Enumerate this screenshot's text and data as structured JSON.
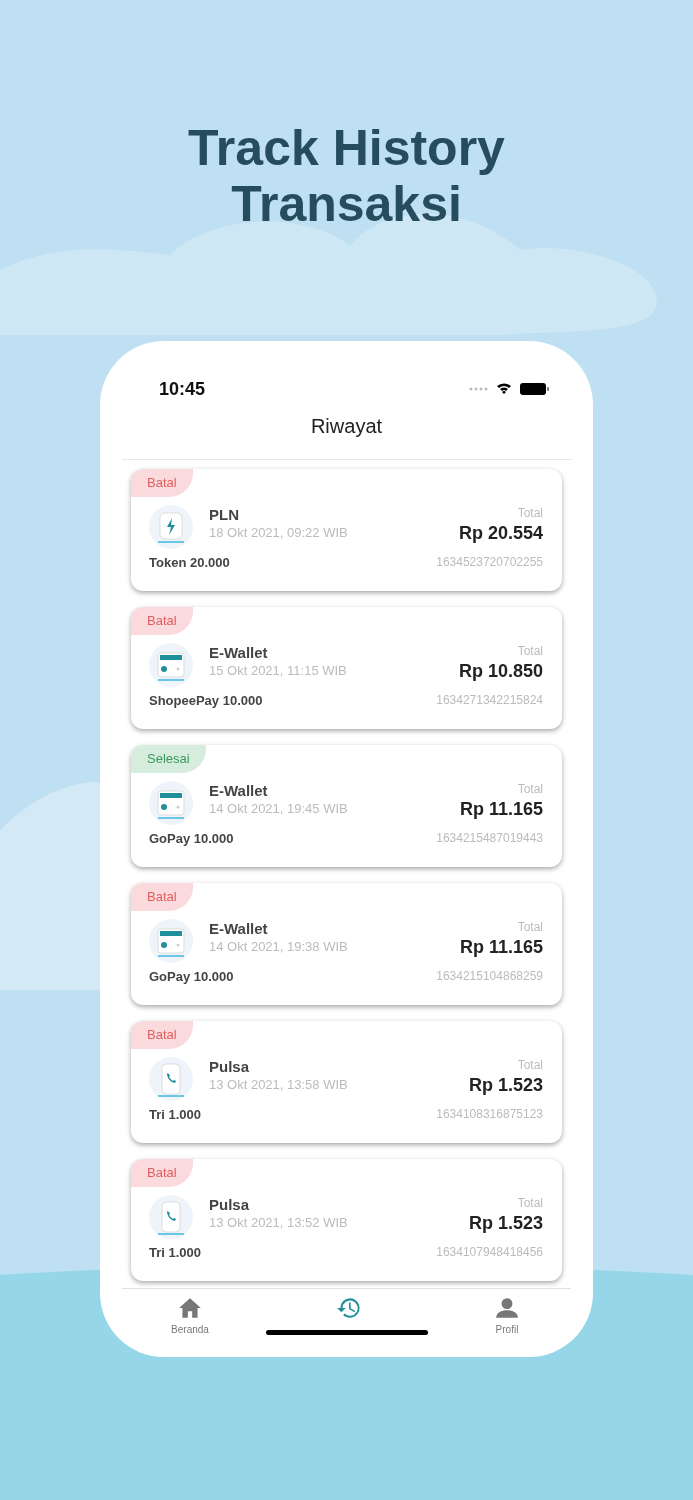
{
  "headline": [
    "Track History",
    "Transaksi"
  ],
  "status_bar": {
    "time": "10:45"
  },
  "header": {
    "title": "Riwayat"
  },
  "transactions": [
    {
      "status": {
        "label": "Batal",
        "kind": "cancelled"
      },
      "kind": "electricity",
      "name": "PLN",
      "date": "18 Okt 2021, 09:22 WIB",
      "product": "Token 20.000",
      "total_label": "Total",
      "amount": "Rp 20.554",
      "reference": "1634523720702255"
    },
    {
      "status": {
        "label": "Batal",
        "kind": "cancelled"
      },
      "kind": "wallet",
      "name": "E-Wallet",
      "date": "15 Okt 2021, 11:15 WIB",
      "product": "ShopeePay 10.000",
      "total_label": "Total",
      "amount": "Rp 10.850",
      "reference": "1634271342215824"
    },
    {
      "status": {
        "label": "Selesai",
        "kind": "done"
      },
      "kind": "wallet",
      "name": "E-Wallet",
      "date": "14 Okt 2021, 19:45 WIB",
      "product": "GoPay 10.000",
      "total_label": "Total",
      "amount": "Rp 11.165",
      "reference": "1634215487019443"
    },
    {
      "status": {
        "label": "Batal",
        "kind": "cancelled"
      },
      "kind": "wallet",
      "name": "E-Wallet",
      "date": "14 Okt 2021, 19:38 WIB",
      "product": "GoPay 10.000",
      "total_label": "Total",
      "amount": "Rp 11.165",
      "reference": "1634215104868259"
    },
    {
      "status": {
        "label": "Batal",
        "kind": "cancelled"
      },
      "kind": "phone",
      "name": "Pulsa",
      "date": "13 Okt 2021, 13:58 WIB",
      "product": "Tri 1.000",
      "total_label": "Total",
      "amount": "Rp 1.523",
      "reference": "1634108316875123"
    },
    {
      "status": {
        "label": "Batal",
        "kind": "cancelled"
      },
      "kind": "phone",
      "name": "Pulsa",
      "date": "13 Okt 2021, 13:52 WIB",
      "product": "Tri 1.000",
      "total_label": "Total",
      "amount": "Rp 1.523",
      "reference": "1634107948418456"
    }
  ],
  "bottom_nav": [
    {
      "kind": "home",
      "label": "Beranda",
      "selected": false
    },
    {
      "kind": "history",
      "selected": true
    },
    {
      "kind": "profile",
      "label": "Profil",
      "selected": false
    }
  ]
}
